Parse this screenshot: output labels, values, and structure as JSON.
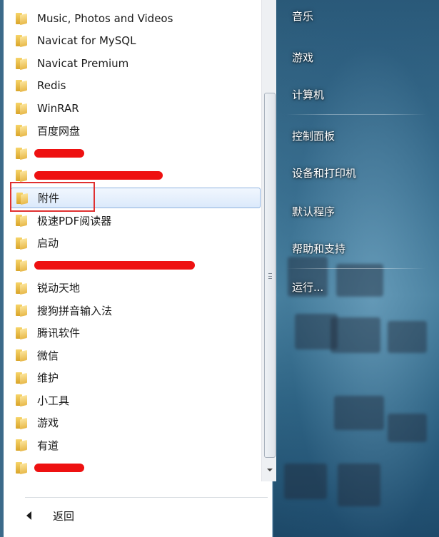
{
  "programs": [
    {
      "label": "Music, Photos and Videos"
    },
    {
      "label": "Navicat for MySQL"
    },
    {
      "label": "Navicat Premium"
    },
    {
      "label": "Redis"
    },
    {
      "label": "WinRAR"
    },
    {
      "label": "百度网盘"
    },
    {
      "label": "",
      "redacted": true
    },
    {
      "label": "",
      "redacted": true
    },
    {
      "label": "附件",
      "selected": true
    },
    {
      "label": "极速PDF阅读器"
    },
    {
      "label": "启动"
    },
    {
      "label": "",
      "redacted": true
    },
    {
      "label": "锐动天地"
    },
    {
      "label": "搜狗拼音输入法"
    },
    {
      "label": "腾讯软件"
    },
    {
      "label": "微信"
    },
    {
      "label": "维护"
    },
    {
      "label": "小工具"
    },
    {
      "label": "游戏"
    },
    {
      "label": "有道"
    },
    {
      "label": "",
      "redacted": true
    }
  ],
  "back_label": "返回",
  "right_items": [
    "音乐",
    "游戏",
    "计算机",
    "控制面板",
    "设备和打印机",
    "默认程序",
    "帮助和支持",
    "运行..."
  ],
  "icons": {
    "folder": "folder-icon",
    "back": "back-arrow-icon",
    "scroll_down": "chevron-down-icon"
  },
  "colors": {
    "highlight_border": "#e03030",
    "redaction": "#ee1111",
    "selection": "#dbe9fb"
  }
}
